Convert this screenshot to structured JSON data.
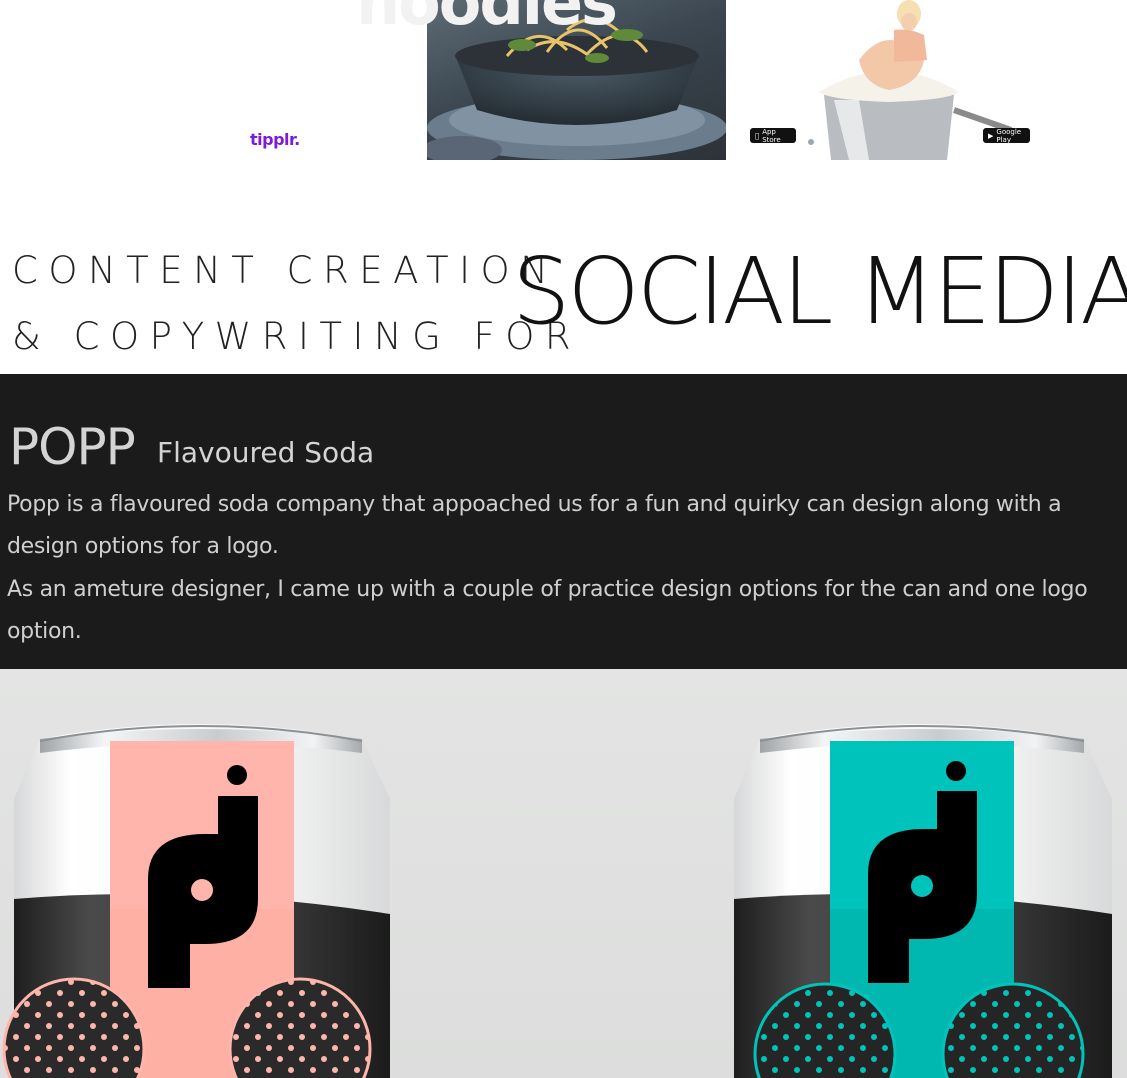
{
  "top_strip": {
    "brand_tipplr": "tipplr.",
    "noodle_word": "noodles",
    "badge_app_store": "App Store",
    "badge_google_play": "Google Play"
  },
  "headline": {
    "line1": "CONTENT CREATION",
    "line2": "& COPYWRITING FOR",
    "big": "SOCIAL MEDIA"
  },
  "project": {
    "title": "POPP",
    "subtitle": "Flavoured Soda",
    "paragraph1": "Popp is a flavoured soda company that appoached us for a fun and quirky can design along with a design options for a logo.",
    "paragraph2": "As an ameture designer, I came up with a couple of practice design options for the can and one logo option."
  },
  "colors": {
    "band_bg": "#1b1b1b",
    "text_light": "#cfcfcf",
    "can_pink": "#ffb5ab",
    "can_teal": "#00c4bb",
    "tipplr_purple": "#7a1cd8"
  },
  "icons": {
    "apple": "apple-icon",
    "google_play": "play-icon",
    "popp_logo": "popp-logo-icon"
  }
}
